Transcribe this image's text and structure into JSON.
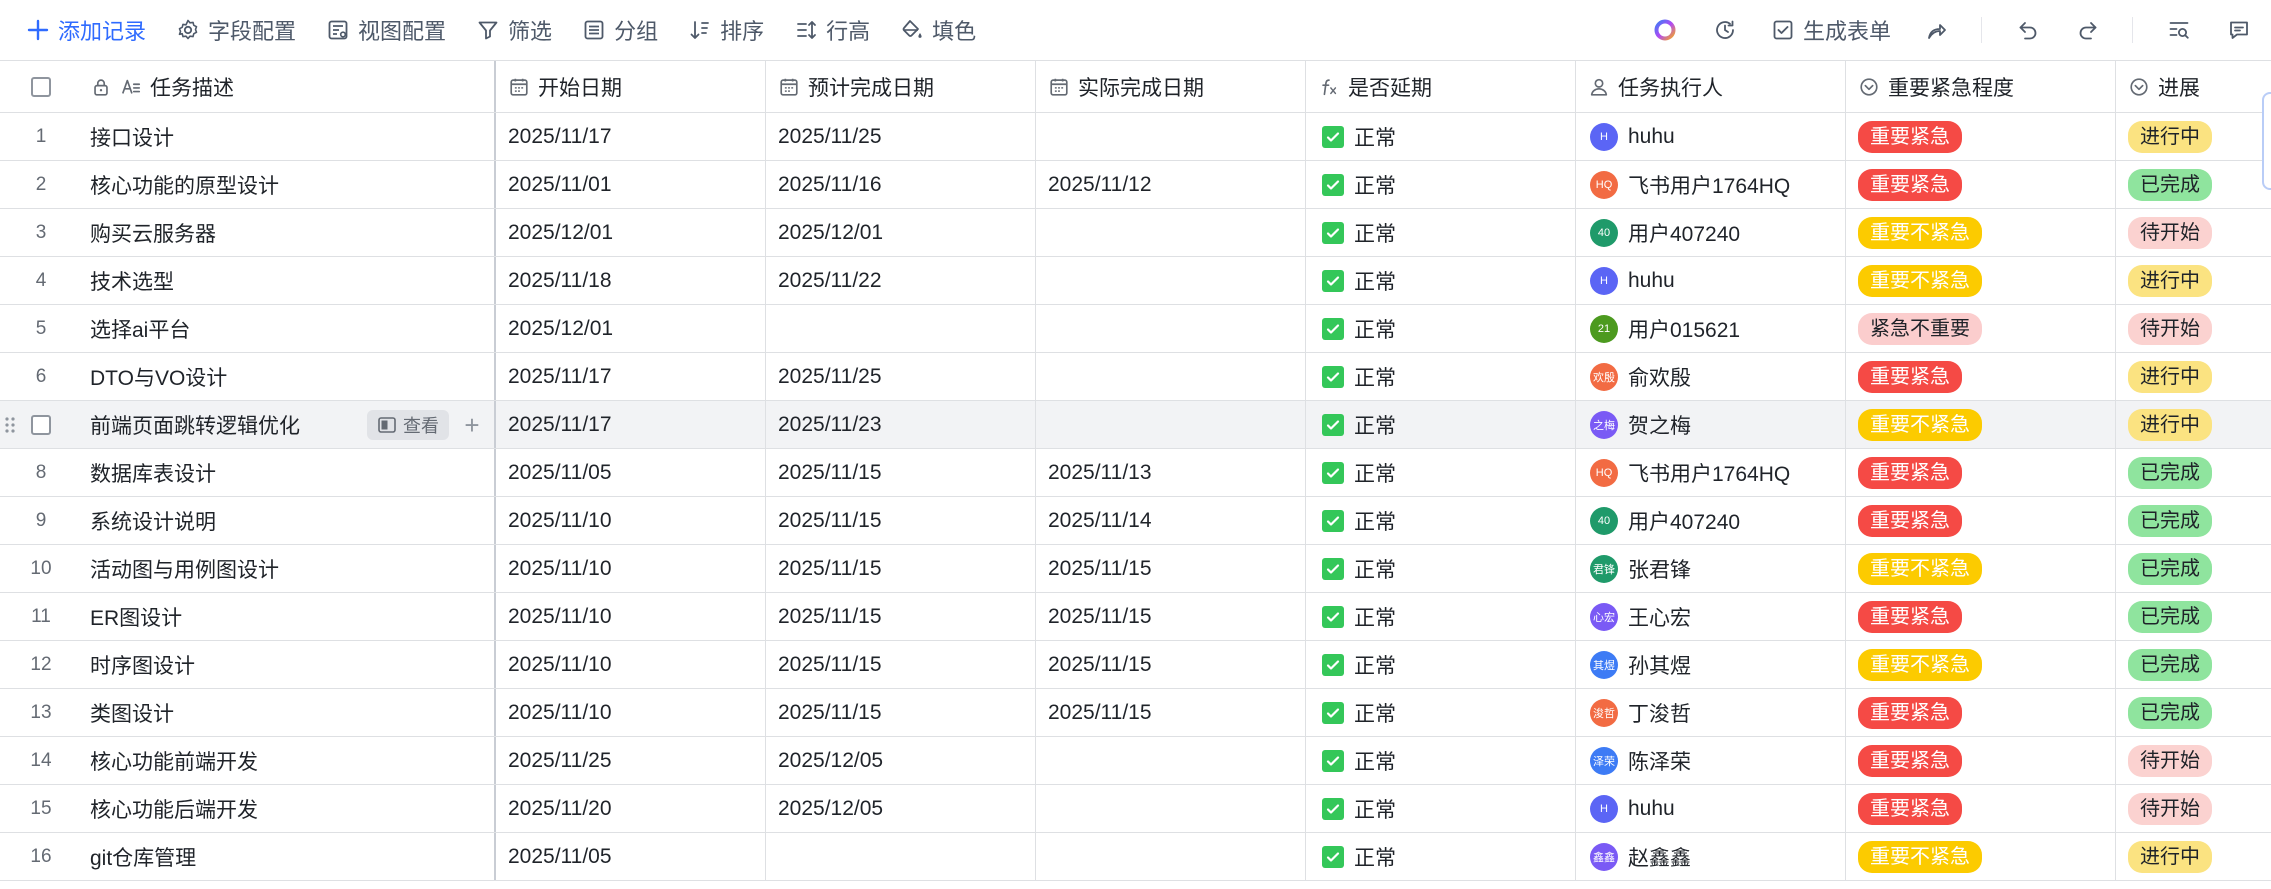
{
  "toolbar": {
    "add_record": "添加记录",
    "field_config": "字段配置",
    "view_config": "视图配置",
    "filter": "筛选",
    "group": "分组",
    "sort": "排序",
    "row_height": "行高",
    "fill_color": "填色",
    "generate_form": "生成表单"
  },
  "columns": {
    "name": "任务描述",
    "start": "开始日期",
    "planned": "预计完成日期",
    "actual": "实际完成日期",
    "delayed": "是否延期",
    "assignee": "任务执行人",
    "priority": "重要紧急程度",
    "progress": "进展"
  },
  "hover_actions": {
    "view": "查看"
  },
  "colors": {
    "red": "#f54a45",
    "yellow": "#fccb00",
    "pink": "#fbcdcd",
    "green": "#8fe49e",
    "amber": "#fbe381",
    "rose": "#fbd2d0",
    "blue": "#2f6bff"
  },
  "rows": [
    {
      "idx": "1",
      "name": "接口设计",
      "start": "2025/11/17",
      "planned": "2025/11/25",
      "actual": "",
      "delayed": "正常",
      "avatar": "H",
      "avatar_color": "#5b65f5",
      "assignee": "huhu",
      "priority": "重要紧急",
      "priority_style": "red",
      "progress": "进行中",
      "progress_style": "amber"
    },
    {
      "idx": "2",
      "name": "核心功能的原型设计",
      "start": "2025/11/01",
      "planned": "2025/11/16",
      "actual": "2025/11/12",
      "delayed": "正常",
      "avatar": "HQ",
      "avatar_color": "#f26b43",
      "assignee": "飞书用户1764HQ",
      "priority": "重要紧急",
      "priority_style": "red",
      "progress": "已完成",
      "progress_style": "green"
    },
    {
      "idx": "3",
      "name": "购买云服务器",
      "start": "2025/12/01",
      "planned": "2025/12/01",
      "actual": "",
      "delayed": "正常",
      "avatar": "40",
      "avatar_color": "#1f9a6a",
      "assignee": "用户407240",
      "priority": "重要不紧急",
      "priority_style": "yellow",
      "progress": "待开始",
      "progress_style": "rose"
    },
    {
      "idx": "4",
      "name": "技术选型",
      "start": "2025/11/18",
      "planned": "2025/11/22",
      "actual": "",
      "delayed": "正常",
      "avatar": "H",
      "avatar_color": "#5b65f5",
      "assignee": "huhu",
      "priority": "重要不紧急",
      "priority_style": "yellow",
      "progress": "进行中",
      "progress_style": "amber"
    },
    {
      "idx": "5",
      "name": "选择ai平台",
      "start": "2025/12/01",
      "planned": "",
      "actual": "",
      "delayed": "正常",
      "avatar": "21",
      "avatar_color": "#4c9a1f",
      "assignee": "用户015621",
      "priority": "紧急不重要",
      "priority_style": "pink",
      "progress": "待开始",
      "progress_style": "rose"
    },
    {
      "idx": "6",
      "name": "DTO与VO设计",
      "start": "2025/11/17",
      "planned": "2025/11/25",
      "actual": "",
      "delayed": "正常",
      "avatar": "欢殷",
      "avatar_color": "#f26b43",
      "assignee": "俞欢殷",
      "priority": "重要紧急",
      "priority_style": "red",
      "progress": "进行中",
      "progress_style": "amber"
    },
    {
      "idx": "7",
      "name": "前端页面跳转逻辑优化",
      "start": "2025/11/17",
      "planned": "2025/11/23",
      "actual": "",
      "delayed": "正常",
      "avatar": "之梅",
      "avatar_color": "#7a5af5",
      "assignee": "贺之梅",
      "priority": "重要不紧急",
      "priority_style": "yellow",
      "progress": "进行中",
      "progress_style": "amber",
      "hover": true
    },
    {
      "idx": "8",
      "name": "数据库表设计",
      "start": "2025/11/05",
      "planned": "2025/11/15",
      "actual": "2025/11/13",
      "delayed": "正常",
      "avatar": "HQ",
      "avatar_color": "#f26b43",
      "assignee": "飞书用户1764HQ",
      "priority": "重要紧急",
      "priority_style": "red",
      "progress": "已完成",
      "progress_style": "green"
    },
    {
      "idx": "9",
      "name": "系统设计说明",
      "start": "2025/11/10",
      "planned": "2025/11/15",
      "actual": "2025/11/14",
      "delayed": "正常",
      "avatar": "40",
      "avatar_color": "#1f9a6a",
      "assignee": "用户407240",
      "priority": "重要紧急",
      "priority_style": "red",
      "progress": "已完成",
      "progress_style": "green"
    },
    {
      "idx": "10",
      "name": "活动图与用例图设计",
      "start": "2025/11/10",
      "planned": "2025/11/15",
      "actual": "2025/11/15",
      "delayed": "正常",
      "avatar": "君锋",
      "avatar_color": "#1f9a6a",
      "assignee": "张君锋",
      "priority": "重要不紧急",
      "priority_style": "yellow",
      "progress": "已完成",
      "progress_style": "green"
    },
    {
      "idx": "11",
      "name": "ER图设计",
      "start": "2025/11/10",
      "planned": "2025/11/15",
      "actual": "2025/11/15",
      "delayed": "正常",
      "avatar": "心宏",
      "avatar_color": "#7a5af5",
      "assignee": "王心宏",
      "priority": "重要紧急",
      "priority_style": "red",
      "progress": "已完成",
      "progress_style": "green"
    },
    {
      "idx": "12",
      "name": "时序图设计",
      "start": "2025/11/10",
      "planned": "2025/11/15",
      "actual": "2025/11/15",
      "delayed": "正常",
      "avatar": "其煜",
      "avatar_color": "#3d7bf5",
      "assignee": "孙其煜",
      "priority": "重要不紧急",
      "priority_style": "yellow",
      "progress": "已完成",
      "progress_style": "green"
    },
    {
      "idx": "13",
      "name": "类图设计",
      "start": "2025/11/10",
      "planned": "2025/11/15",
      "actual": "2025/11/15",
      "delayed": "正常",
      "avatar": "浚哲",
      "avatar_color": "#f26b43",
      "assignee": "丁浚哲",
      "priority": "重要紧急",
      "priority_style": "red",
      "progress": "已完成",
      "progress_style": "green"
    },
    {
      "idx": "14",
      "name": "核心功能前端开发",
      "start": "2025/11/25",
      "planned": "2025/12/05",
      "actual": "",
      "delayed": "正常",
      "avatar": "泽荣",
      "avatar_color": "#3d7bf5",
      "assignee": "陈泽荣",
      "priority": "重要紧急",
      "priority_style": "red",
      "progress": "待开始",
      "progress_style": "rose"
    },
    {
      "idx": "15",
      "name": "核心功能后端开发",
      "start": "2025/11/20",
      "planned": "2025/12/05",
      "actual": "",
      "delayed": "正常",
      "avatar": "H",
      "avatar_color": "#5b65f5",
      "assignee": "huhu",
      "priority": "重要紧急",
      "priority_style": "red",
      "progress": "待开始",
      "progress_style": "rose"
    },
    {
      "idx": "16",
      "name": "git仓库管理",
      "start": "2025/11/05",
      "planned": "",
      "actual": "",
      "delayed": "正常",
      "avatar": "鑫鑫",
      "avatar_color": "#7a5af5",
      "assignee": "赵鑫鑫",
      "priority": "重要不紧急",
      "priority_style": "yellow",
      "progress": "进行中",
      "progress_style": "amber"
    }
  ]
}
